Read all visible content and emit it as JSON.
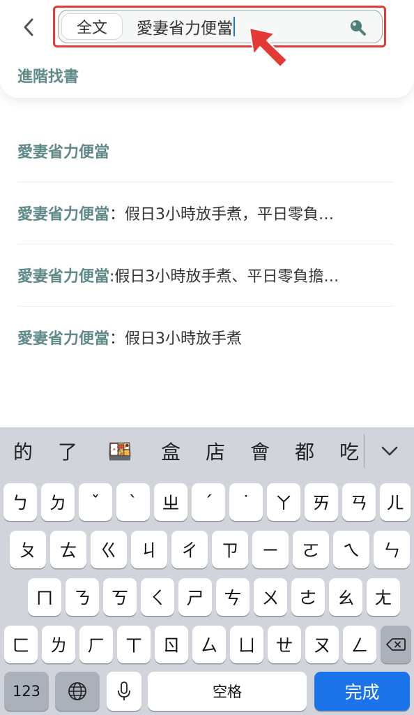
{
  "header": {
    "search_scope": "全文",
    "query": "愛妻省力便當",
    "advanced_label": "進階找書"
  },
  "suggestions": [
    {
      "keyword": "愛妻省力便當",
      "rest": ""
    },
    {
      "keyword": "愛妻省力便當",
      "rest": "：假日3小時放手煮，平日零負…"
    },
    {
      "keyword": "愛妻省力便當",
      "rest": ":假日3小時放手煮、平日零負擔…"
    },
    {
      "keyword": "愛妻省力便當",
      "rest": "：假日3小時放手煮"
    }
  ],
  "keyboard": {
    "candidates": [
      "的",
      "了",
      "🍱",
      "盒",
      "店",
      "會",
      "都",
      "吃"
    ],
    "row1": [
      "ㄅ",
      "ㄉ",
      "ˇ",
      "ˋ",
      "ㄓ",
      "ˊ",
      "˙",
      "ㄚ",
      "ㄞ",
      "ㄢ",
      "ㄦ"
    ],
    "row2": [
      "ㄆ",
      "ㄊ",
      "ㄍ",
      "ㄐ",
      "ㄔ",
      "ㄗ",
      "ㄧ",
      "ㄛ",
      "ㄟ",
      "ㄣ"
    ],
    "row3": [
      "ㄇ",
      "ㄋ",
      "ㄎ",
      "ㄑ",
      "ㄕ",
      "ㄘ",
      "ㄨ",
      "ㄜ",
      "ㄠ",
      "ㄤ"
    ],
    "row4": [
      "ㄈ",
      "ㄌ",
      "ㄏ",
      "ㄒ",
      "ㄖ",
      "ㄙ",
      "ㄩ",
      "ㄝ",
      "ㄡ",
      "ㄥ"
    ],
    "numbers_label": "123",
    "space_label": "空格",
    "done_label": "完成",
    "icons": [
      "back-icon",
      "search-icon",
      "arrow-pointer-icon",
      "chevron-down-icon",
      "backspace-icon",
      "globe-icon",
      "microphone-icon"
    ],
    "accent_color": "#1a73e8",
    "highlight_color": "#e53935",
    "brand_color": "#5f8a88"
  }
}
